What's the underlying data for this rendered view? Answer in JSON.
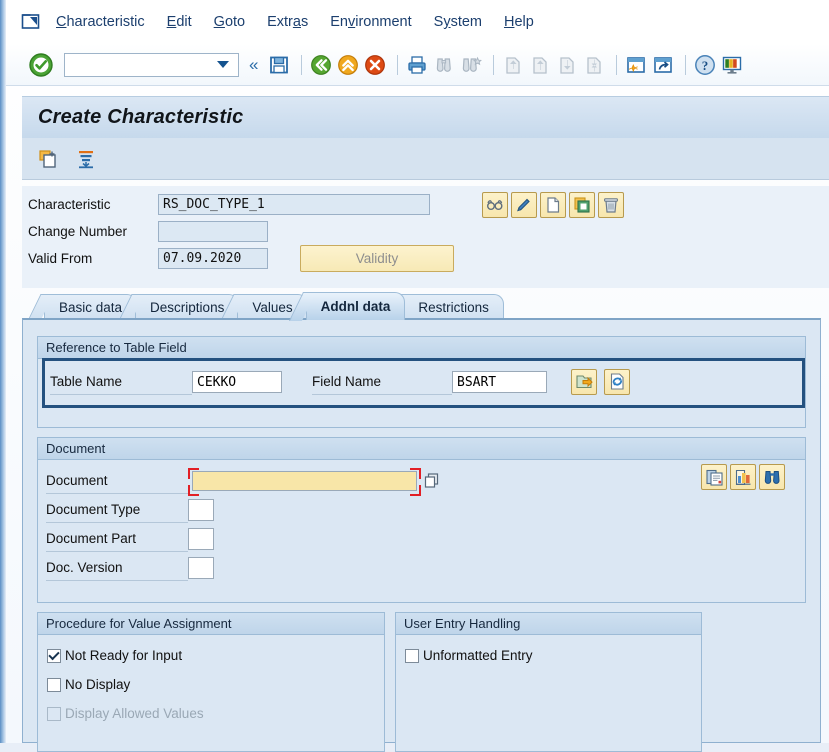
{
  "window": {
    "menu_items": [
      {
        "label": "Characteristic",
        "accel_index": 0
      },
      {
        "label": "Edit",
        "accel_index": 0
      },
      {
        "label": "Goto",
        "accel_index": 0
      },
      {
        "label": "Extras",
        "accel_index": 4
      },
      {
        "label": "Environment",
        "accel_index": 3
      },
      {
        "label": "System",
        "accel_index": 1
      },
      {
        "label": "Help",
        "accel_index": 1
      }
    ],
    "system_icon": "sap-system-menu-icon"
  },
  "toolbar": {
    "command_value": "",
    "ok_icon": "green-check-enter-icon",
    "dropdown_icon": "chevron-down-icon",
    "collapse_icon": "double-chevron-left-icon",
    "buttons": [
      {
        "name": "save-button",
        "icon": "floppy-save-icon",
        "enabled": true
      },
      {
        "name": "back-button",
        "icon": "green-back-arrow-icon",
        "enabled": true
      },
      {
        "name": "exit-button",
        "icon": "orange-up-arrow-exit-icon",
        "enabled": true
      },
      {
        "name": "cancel-button",
        "icon": "red-cancel-x-icon",
        "enabled": true
      },
      {
        "name": "print-button",
        "icon": "printer-icon",
        "enabled": true
      },
      {
        "name": "find-button",
        "icon": "binoculars-find-icon",
        "enabled": false
      },
      {
        "name": "find-next-button",
        "icon": "binoculars-find-next-icon",
        "enabled": false
      },
      {
        "name": "first-page-button",
        "icon": "first-page-icon",
        "enabled": false
      },
      {
        "name": "previous-page-button",
        "icon": "previous-page-icon",
        "enabled": false
      },
      {
        "name": "next-page-button",
        "icon": "next-page-icon",
        "enabled": false
      },
      {
        "name": "last-page-button",
        "icon": "last-page-icon",
        "enabled": false
      },
      {
        "name": "create-session-button",
        "icon": "new-session-icon",
        "enabled": true
      },
      {
        "name": "create-shortcut-button",
        "icon": "shortcut-arrow-icon",
        "enabled": true
      },
      {
        "name": "help-button",
        "icon": "question-help-icon",
        "enabled": true
      },
      {
        "name": "customize-layout-button",
        "icon": "customize-local-layout-icon",
        "enabled": true
      }
    ]
  },
  "page": {
    "title": "Create Characteristic",
    "app_buttons": [
      {
        "name": "new-characteristic-button",
        "icon": "new-document-icon"
      },
      {
        "name": "value-assignment-button",
        "icon": "stacked-lines-icon"
      }
    ]
  },
  "header": {
    "fields": [
      {
        "label": "Characteristic",
        "value": "RS_DOC_TYPE_1"
      },
      {
        "label": "Change Number",
        "value": ""
      },
      {
        "label": "Valid From",
        "value": "07.09.2020"
      }
    ],
    "validity_button": "Validity",
    "action_icons": [
      {
        "name": "display-glasses-icon"
      },
      {
        "name": "edit-pencil-icon"
      },
      {
        "name": "create-blank-page-icon"
      },
      {
        "name": "copy-from-icon"
      },
      {
        "name": "delete-trash-icon"
      }
    ]
  },
  "tabs": [
    {
      "label": "Basic data",
      "selected": false
    },
    {
      "label": "Descriptions",
      "selected": false
    },
    {
      "label": "Values",
      "selected": false
    },
    {
      "label": "Addnl data",
      "selected": true
    },
    {
      "label": "Restrictions",
      "selected": false
    }
  ],
  "reference_group": {
    "title": "Reference to Table Field",
    "table_name_label": "Table Name",
    "table_name_value": "CEKKO",
    "field_name_label": "Field Name",
    "field_name_value": "BSART",
    "buttons": [
      {
        "name": "goto-table-field-button",
        "icon": "arrow-to-folder-icon"
      },
      {
        "name": "refresh-reference-button",
        "icon": "refresh-document-icon"
      }
    ],
    "focus_outline_color": "#24517f"
  },
  "document_group": {
    "title": "Document",
    "rows": [
      {
        "label": "Document",
        "value": "",
        "focused": true
      },
      {
        "label": "Document Type",
        "value": "",
        "focused": false
      },
      {
        "label": "Document Part",
        "value": "",
        "focused": false
      },
      {
        "label": "Doc. Version",
        "value": "",
        "focused": false
      }
    ],
    "f4_help_icon": "value-help-icon",
    "buttons": [
      {
        "name": "document-detail-button",
        "icon": "document-overview-icon"
      },
      {
        "name": "document-structure-button",
        "icon": "bar-chart-icon"
      },
      {
        "name": "document-find-button",
        "icon": "binoculars-find-icon"
      }
    ],
    "field_focus_color": "#e21f25",
    "field_focus_fill": "#f8e6a8"
  },
  "value_assignment_group": {
    "title": "Procedure for Value Assignment",
    "checkboxes": [
      {
        "label": "Not Ready for Input",
        "checked": true,
        "enabled": true
      },
      {
        "label": "No Display",
        "checked": false,
        "enabled": true
      },
      {
        "label": "Display Allowed Values",
        "checked": false,
        "enabled": false
      }
    ]
  },
  "user_entry_group": {
    "title": "User Entry Handling",
    "checkboxes": [
      {
        "label": "Unformatted Entry",
        "checked": false,
        "enabled": true
      }
    ]
  },
  "colors": {
    "panel_bg": "#dbe7f3",
    "header_bg": "#eaf1f9",
    "title_bg": "#c6d9ec",
    "menu_text": "#1c3f6e",
    "accent_border": "#9dbbd6"
  }
}
